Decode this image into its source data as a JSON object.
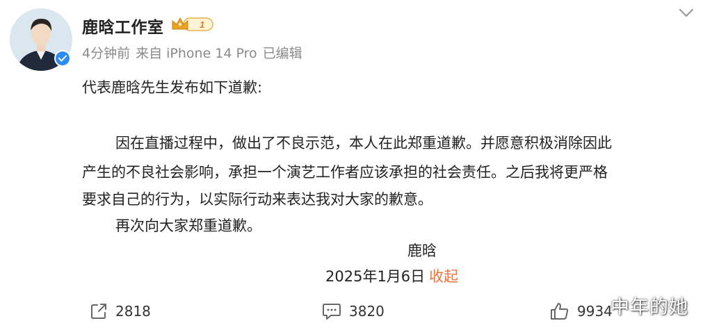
{
  "post": {
    "author": {
      "name": "鹿晗工作室",
      "vip_level": "1"
    },
    "meta": {
      "time": "4分钟前",
      "source": "来自 iPhone 14 Pro",
      "edited": "已编辑"
    },
    "body": {
      "line1": "代表鹿晗先生发布如下道歉:",
      "line2": "因在直播过程中，做出了不良示范，本人在此郑重道歉。并愿意积极消除因此",
      "line3": "产生的不良社会影响，承担一个演艺工作者应该承担的社会责任。之后我将更严格",
      "line4": "要求自己的行为，以实际行动来表达我对大家的歉意。",
      "line5": "再次向大家郑重道歉。",
      "signature": "鹿晗",
      "date": "2025年1月6日",
      "collapse": "收起"
    },
    "actions": {
      "shares": "2818",
      "comments": "3820",
      "likes": "9934"
    }
  },
  "watermark": "中年的她",
  "colors": {
    "link": "#eb7340",
    "verified": "#2c8cf4",
    "meta": "#8a8a8a"
  }
}
